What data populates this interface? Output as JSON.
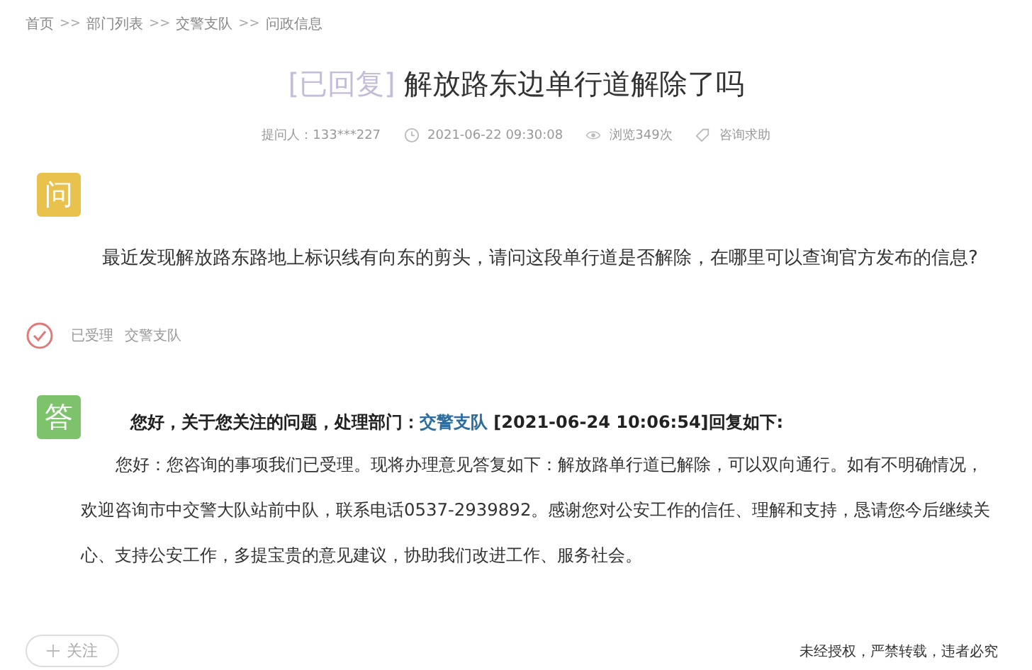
{
  "breadcrumb": [
    {
      "kind": "link",
      "text": "首页"
    },
    {
      "kind": "separator",
      "text": ">>"
    },
    {
      "kind": "link",
      "text": "部门列表"
    },
    {
      "kind": "separator",
      "text": ">>"
    },
    {
      "kind": "link",
      "text": "交警支队"
    },
    {
      "kind": "separator",
      "text": ">>"
    },
    {
      "kind": "current",
      "text": "问政信息"
    }
  ],
  "title": {
    "status": "[已回复]",
    "text": "解放路东边单行道解除了吗"
  },
  "meta": {
    "asker": "提问人：133***227",
    "time": "2021-06-22 09:30:08",
    "views": "浏览349次",
    "category": "咨询求助"
  },
  "question": {
    "badge": "问",
    "text": "最近发现解放路东路地上标识线有向东的剪头，请问这段单行道是否解除，在哪里可以查询官方发布的信息?"
  },
  "progress": {
    "status": "已受理",
    "department": "交警支队"
  },
  "answer": {
    "badge": "答",
    "heading_prefix": "您好，关于您关注的问题，处理部门：",
    "department": "交警支队",
    "heading_suffix": " [2021-06-24 10:06:54]回复如下:",
    "text": "您好：您咨询的事项我们已受理。现将办理意见答复如下：解放路单行道已解除，可以双向通行。如有不明确情况，欢迎咨询市中交警大队站前中队，联系电话0537-2939892。感谢您对公安工作的信任、理解和支持，恳请您今后继续关心、支持公安工作，多提宝贵的意见建议，协助我们改进工作、服务社会。"
  },
  "follow_button": "关注",
  "footer": "未经授权，严禁转载，违者必究"
}
